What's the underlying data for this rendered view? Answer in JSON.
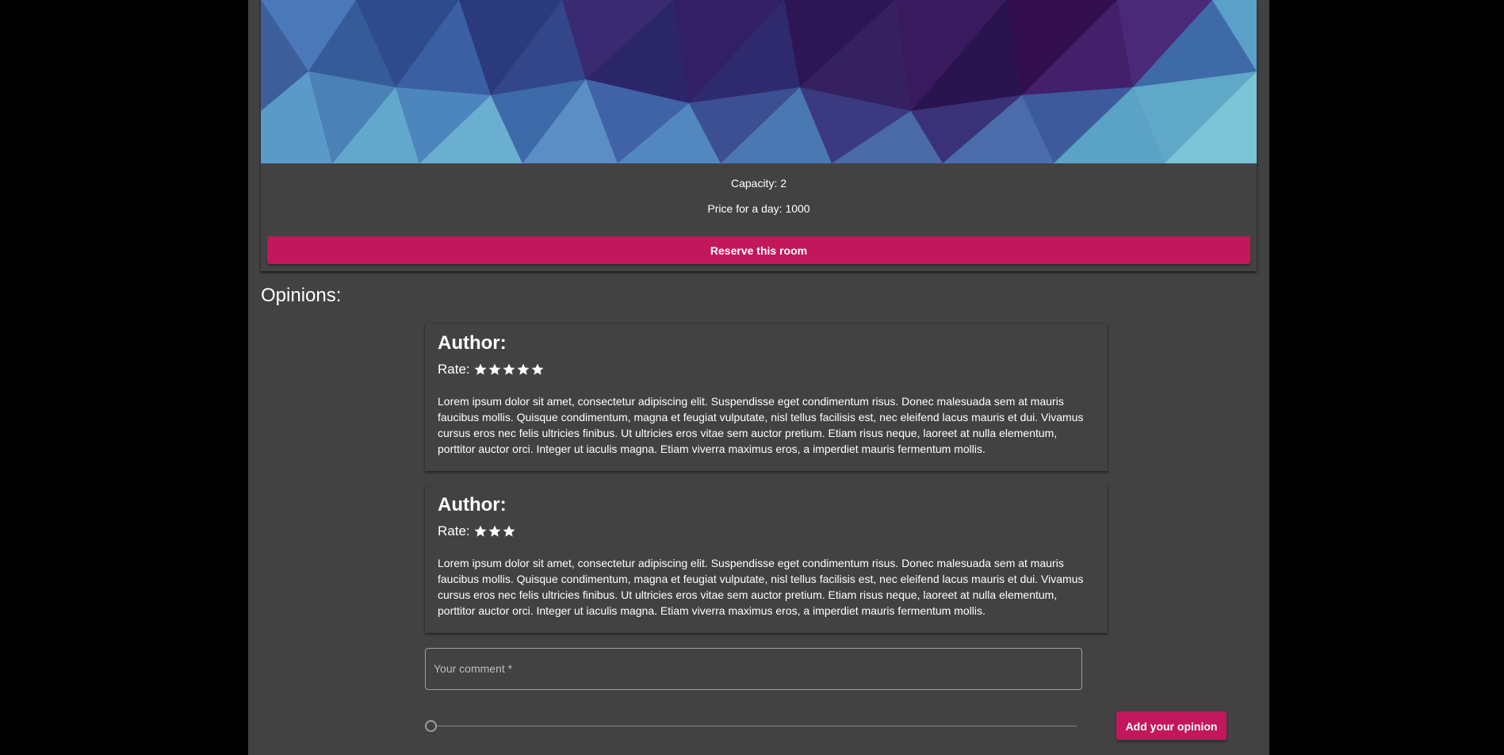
{
  "room": {
    "capacity": "Capacity: 2",
    "price": "Price for a day: 1000",
    "reserve_label": "Reserve this room"
  },
  "opinions": {
    "heading": "Opinions:",
    "items": [
      {
        "author": "Author:",
        "rate_label": "Rate:",
        "rating": 5,
        "text": "Lorem ipsum dolor sit amet, consectetur adipiscing elit. Suspendisse eget condimentum risus. Donec malesuada sem at mauris faucibus mollis. Quisque condimentum, magna et feugiat vulputate, nisl tellus facilisis est, nec eleifend lacus mauris et dui. Vivamus cursus eros nec felis ultricies finibus. Ut ultricies eros vitae sem auctor pretium. Etiam risus neque, laoreet at nulla elementum, porttitor auctor orci. Integer ut iaculis magna. Etiam viverra maximus eros, a imperdiet mauris fermentum mollis."
      },
      {
        "author": "Author:",
        "rate_label": "Rate:",
        "rating": 3,
        "text": "Lorem ipsum dolor sit amet, consectetur adipiscing elit. Suspendisse eget condimentum risus. Donec malesuada sem at mauris faucibus mollis. Quisque condimentum, magna et feugiat vulputate, nisl tellus facilisis est, nec eleifend lacus mauris et dui. Vivamus cursus eros nec felis ultricies finibus. Ut ultricies eros vitae sem auctor pretium. Etiam risus neque, laoreet at nulla elementum, porttitor auctor orci. Integer ut iaculis magna. Etiam viverra maximus eros, a imperdiet mauris fermentum mollis."
      }
    ]
  },
  "form": {
    "comment_placeholder": "Your comment *",
    "rating_value": 0,
    "add_label": "Add your opinion"
  },
  "colors": {
    "accent": "#c2185b",
    "surface": "#424242",
    "background": "#000000"
  },
  "icons": {
    "star": "star-icon"
  }
}
